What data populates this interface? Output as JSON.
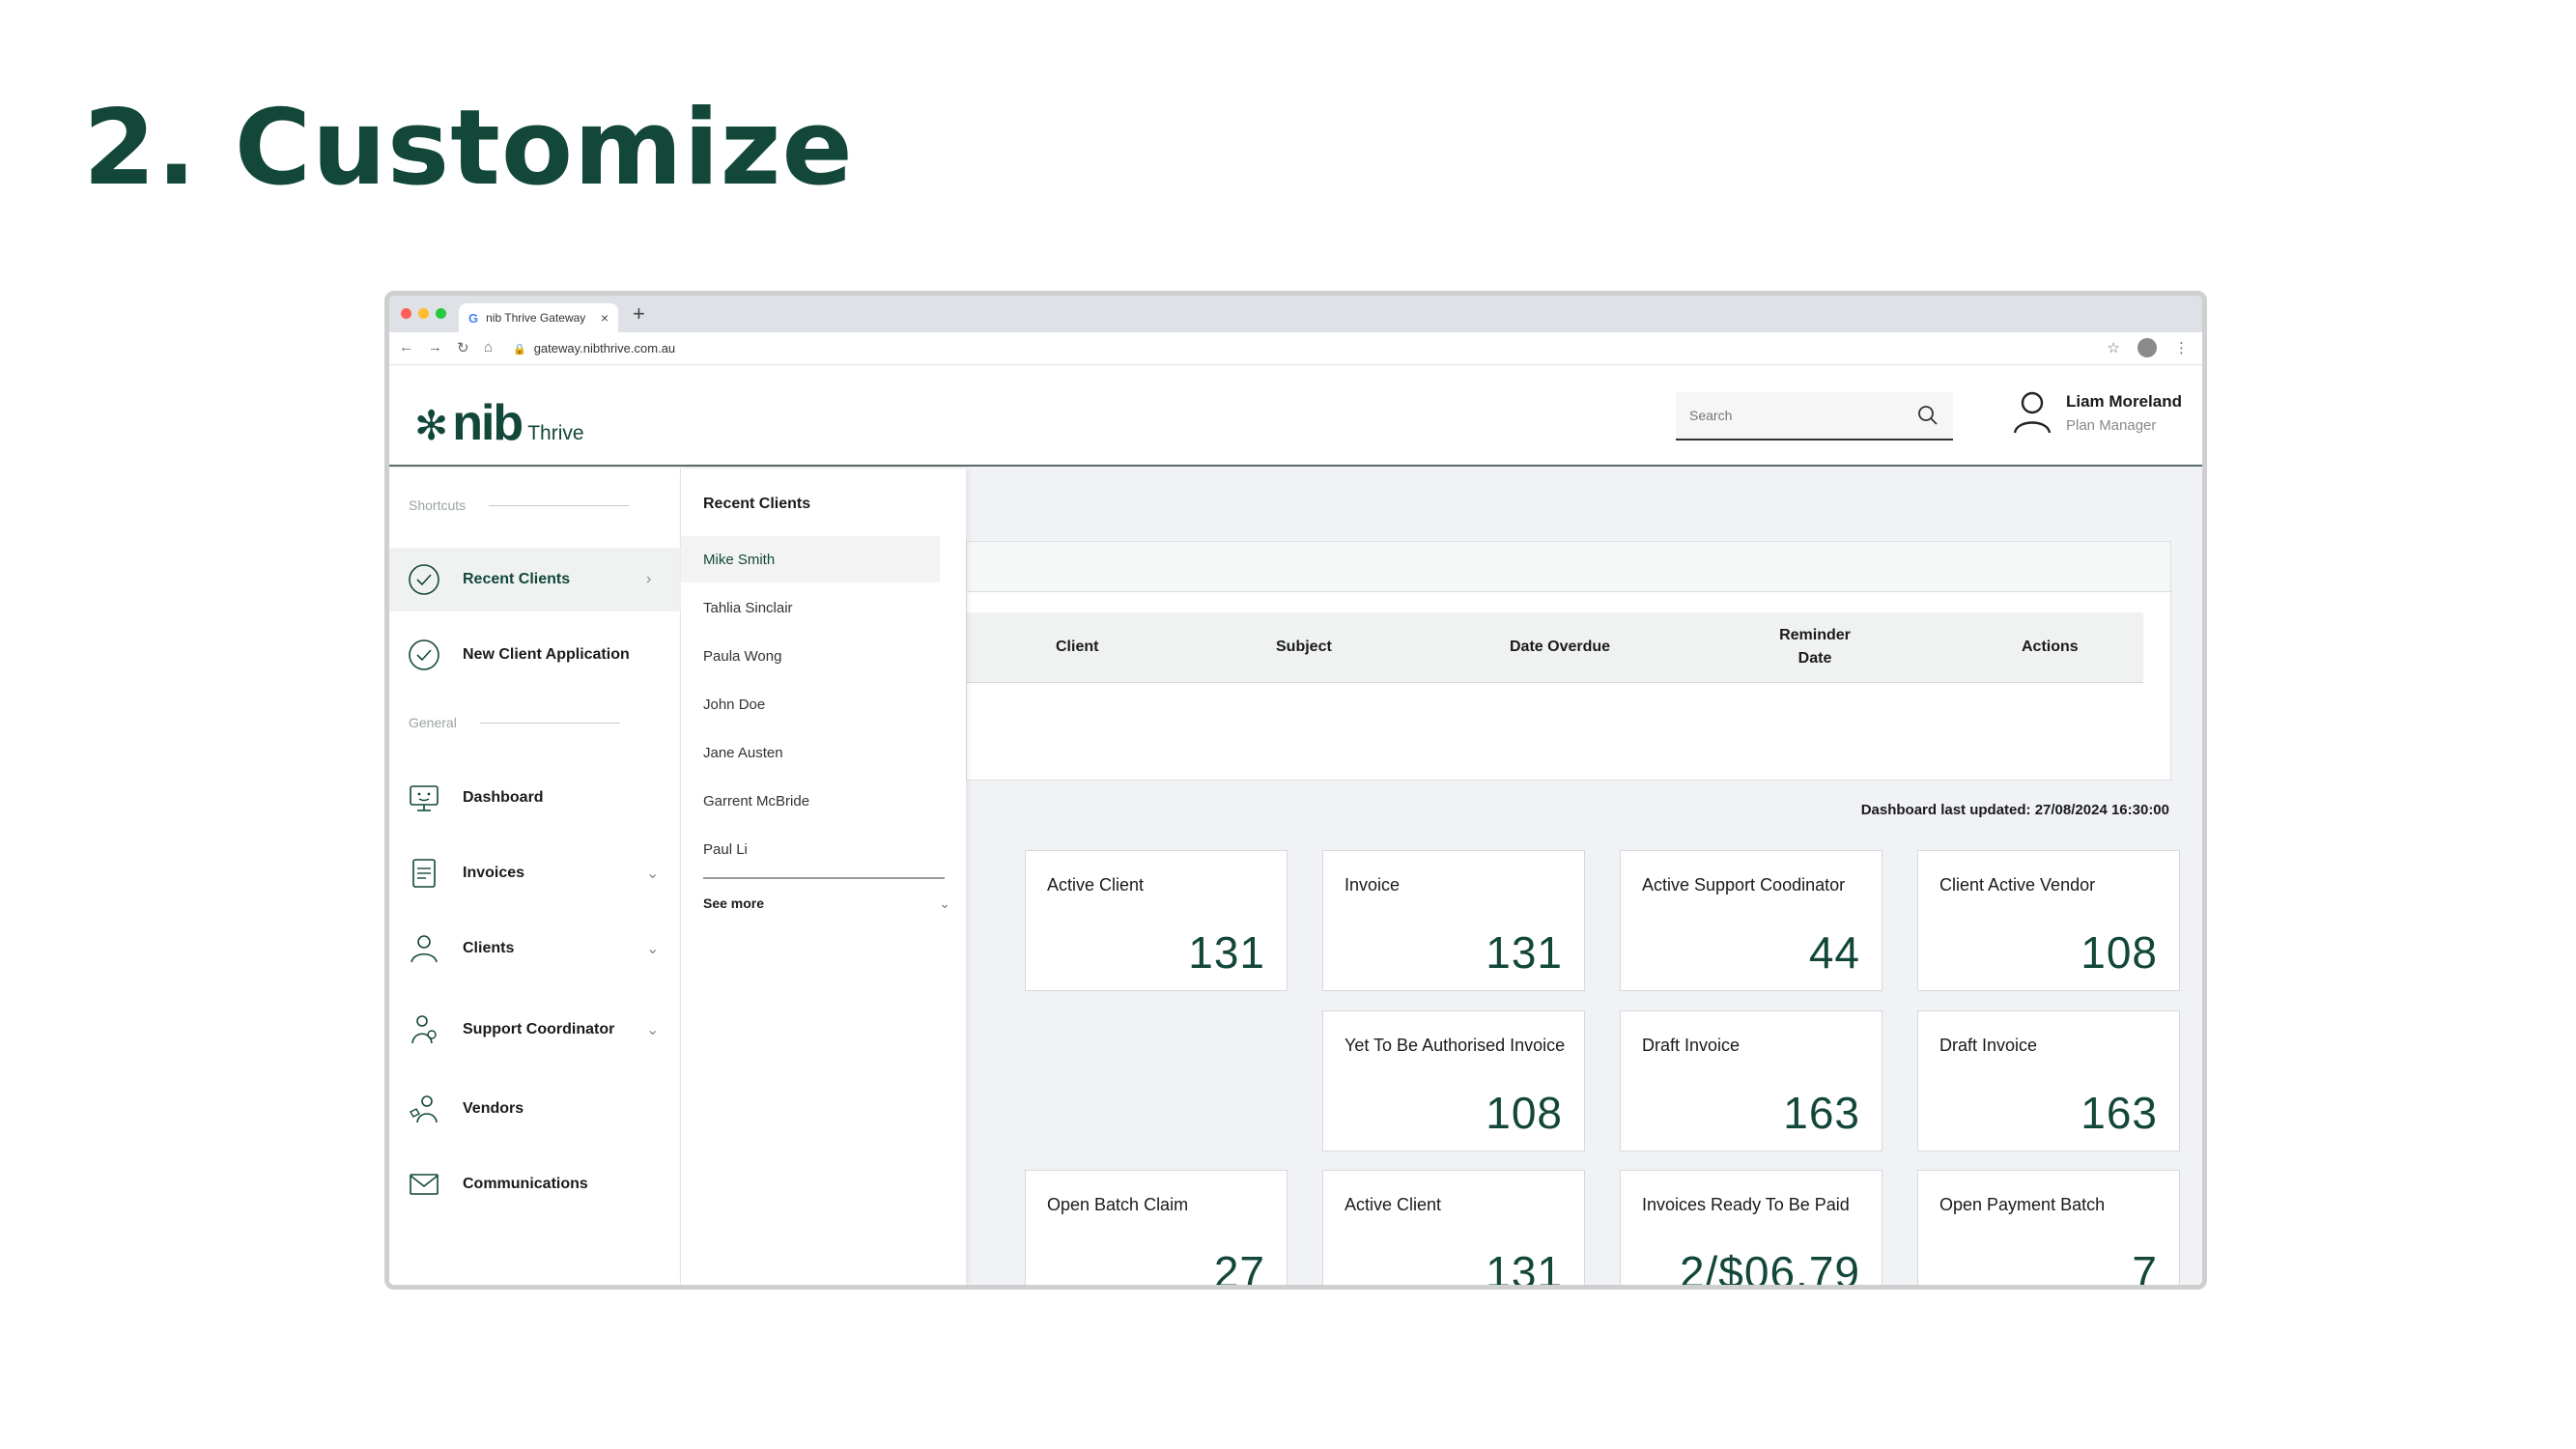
{
  "slide": {
    "title": "2. Customize"
  },
  "browser": {
    "tab_title": "nib Thrive Gateway",
    "tab_icon": "G",
    "url": "gateway.nibthrive.com.au"
  },
  "app": {
    "logo": {
      "nib": "nib",
      "thrive": "Thrive"
    },
    "search": {
      "placeholder": "Search"
    },
    "user": {
      "name": "Liam Moreland",
      "role": "Plan Manager"
    }
  },
  "sidebar": {
    "shortcuts_label": "Shortcuts",
    "general_label": "General",
    "items": [
      {
        "label": "Recent Clients",
        "icon": "check-circle-icon",
        "chevron": "right"
      },
      {
        "label": "New Client Application",
        "icon": "check-circle-icon"
      },
      {
        "label": "Dashboard",
        "icon": "monitor-icon"
      },
      {
        "label": "Invoices",
        "icon": "document-icon",
        "chevron": "down"
      },
      {
        "label": "Clients",
        "icon": "person-icon",
        "chevron": "down"
      },
      {
        "label": "Support Coordinator",
        "icon": "coordinator-icon",
        "chevron": "down"
      },
      {
        "label": "Vendors",
        "icon": "vendor-icon"
      },
      {
        "label": "Communications",
        "icon": "envelope-icon"
      }
    ]
  },
  "recent_clients": {
    "title": "Recent Clients",
    "items": [
      "Mike Smith",
      "Tahlia Sinclair",
      "Paula Wong",
      "John Doe",
      "Jane Austen",
      "Garrent McBride",
      "Paul Li"
    ],
    "see_more": "See more"
  },
  "table": {
    "columns": [
      "Client",
      "Subject",
      "Date Overdue",
      "Reminder Date",
      "Actions"
    ]
  },
  "dashboard": {
    "updated_label": "Dashboard last updated: 27/08/2024 16:30:00",
    "tiles": [
      {
        "label": "Active Client",
        "value": "131"
      },
      {
        "label": "Invoice",
        "value": "131"
      },
      {
        "label": "Active Support Coodinator",
        "value": "44"
      },
      {
        "label": "Client Active Vendor",
        "value": "108"
      },
      {
        "label": "Yet To Be Authorised Invoice",
        "value": "108"
      },
      {
        "label": "Draft Invoice",
        "value": "163"
      },
      {
        "label": "Draft Invoice",
        "value": "163"
      },
      {
        "label": "Open Batch Claim",
        "value": "27"
      },
      {
        "label": "Active Client",
        "value": "131"
      },
      {
        "label": "Invoices Ready To Be Paid",
        "value": "2/$06.79"
      },
      {
        "label": "Open Payment Batch",
        "value": "7"
      }
    ]
  },
  "colors": {
    "brand": "#12473a",
    "background": "#f0f2f5"
  }
}
